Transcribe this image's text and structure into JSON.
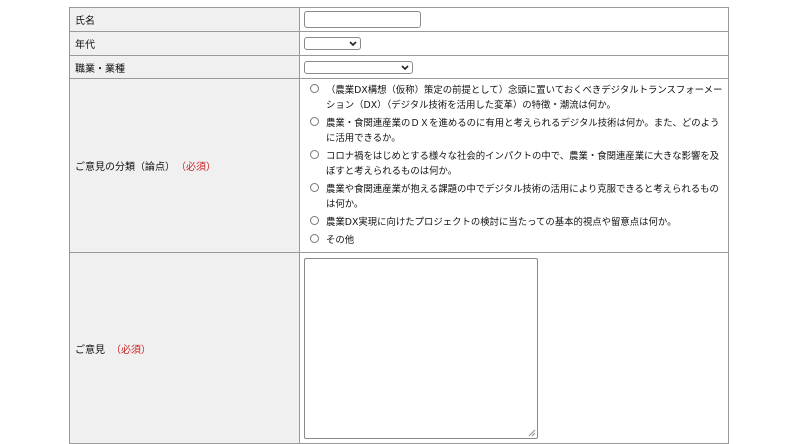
{
  "form": {
    "name": {
      "label": "氏名",
      "value": ""
    },
    "age": {
      "label": "年代",
      "selected": ""
    },
    "occupation": {
      "label": "職業・業種",
      "selected": ""
    },
    "category": {
      "label": "ご意見の分類（論点）",
      "required": "（必須）",
      "options": [
        "（農業DX構想（仮称）策定の前提として）念頭に置いておくべきデジタルトランスフォーメーション（DX）（デジタル技術を活用した変革）の特徴・潮流は何か。",
        "農業・食関連産業のＤＸを進めるのに有用と考えられるデジタル技術は何か。また、どのように活用できるか。",
        "コロナ禍をはじめとする様々な社会的インパクトの中で、農業・食関連産業に大きな影響を及ぼすと考えられるものは何か。",
        "農業や食関連産業が抱える課題の中でデジタル技術の活用により克服できると考えられるものは何か。",
        "農業DX実現に向けたプロジェクトの検討に当たっての基本的視点や留意点は何か。",
        "その他"
      ]
    },
    "opinion": {
      "label": "ご意見",
      "required": "（必須）",
      "value": ""
    }
  },
  "icons": {
    "select_chevron": "chevron-down-icon",
    "textarea_resize": "resize-grip-icon"
  },
  "colors": {
    "label_bg": "#f0f0f0",
    "border": "#9a9a9a",
    "required": "#cc2222"
  }
}
